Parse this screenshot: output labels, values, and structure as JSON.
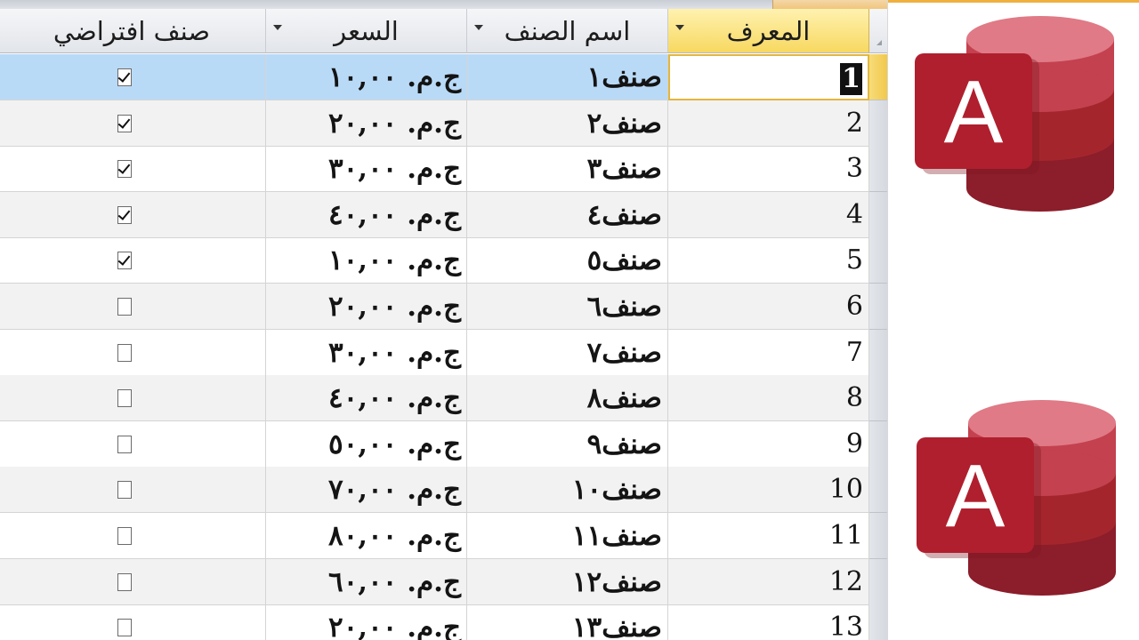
{
  "columns": [
    {
      "key": "id",
      "label": "المعرف"
    },
    {
      "key": "name",
      "label": "اسم الصنف"
    },
    {
      "key": "price",
      "label": "السعر"
    },
    {
      "key": "default",
      "label": "صنف افتراضي"
    }
  ],
  "rows": [
    {
      "id": "1",
      "name": "صنف١",
      "price": "ج.م. ١٠,٠٠",
      "default": true
    },
    {
      "id": "2",
      "name": "صنف٢",
      "price": "ج.م. ٢٠,٠٠",
      "default": true
    },
    {
      "id": "3",
      "name": "صنف٣",
      "price": "ج.م. ٣٠,٠٠",
      "default": true
    },
    {
      "id": "4",
      "name": "صنف٤",
      "price": "ج.م. ٤٠,٠٠",
      "default": true
    },
    {
      "id": "5",
      "name": "صنف٥",
      "price": "ج.م. ١٠,٠٠",
      "default": true
    },
    {
      "id": "6",
      "name": "صنف٦",
      "price": "ج.م. ٢٠,٠٠",
      "default": false
    },
    {
      "id": "7",
      "name": "صنف٧",
      "price": "ج.م. ٣٠,٠٠",
      "default": false
    },
    {
      "id": "8",
      "name": "صنف٨",
      "price": "ج.م. ٤٠,٠٠",
      "default": false
    },
    {
      "id": "9",
      "name": "صنف٩",
      "price": "ج.م. ٥٠,٠٠",
      "default": false
    },
    {
      "id": "10",
      "name": "صنف١٠",
      "price": "ج.م. ٧٠,٠٠",
      "default": false
    },
    {
      "id": "11",
      "name": "صنف١١",
      "price": "ج.م. ٨٠,٠٠",
      "default": false
    },
    {
      "id": "12",
      "name": "صنف١٢",
      "price": "ج.م. ٦٠,٠٠",
      "default": false
    },
    {
      "id": "13",
      "name": "صنف١٣",
      "price": "ج.م. ٢٠,٠٠",
      "default": false
    }
  ],
  "current_row": 0,
  "logos": [
    {
      "icon": "access-logo-icon",
      "letter": "A"
    },
    {
      "icon": "access-logo-icon",
      "letter": "A"
    }
  ],
  "colors": {
    "accent_header": "#f7d860",
    "selected_row": "#b9daf7",
    "access_red": "#a4262c"
  }
}
